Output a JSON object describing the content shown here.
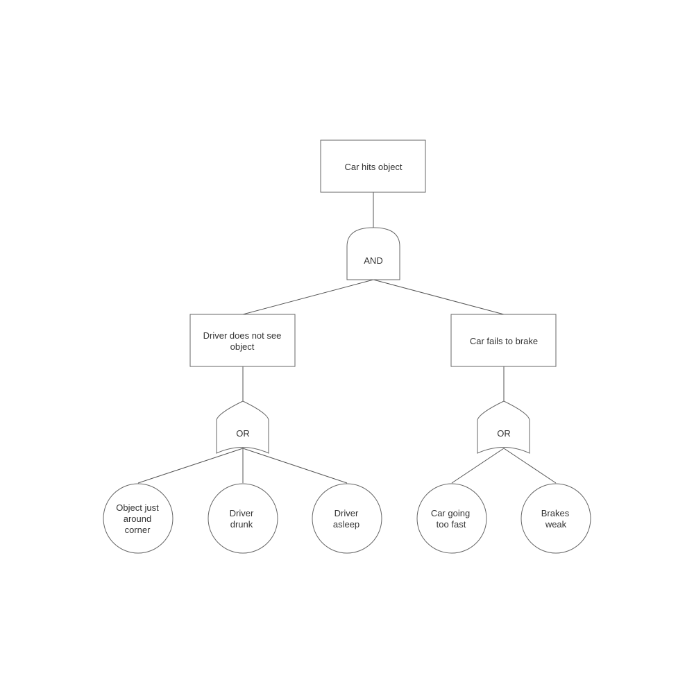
{
  "diagram": {
    "type": "fault-tree",
    "top_event": {
      "lines": [
        "Car hits object"
      ]
    },
    "and_gate": {
      "label": "AND"
    },
    "intermediate_events": [
      {
        "lines": [
          "Driver does not see",
          "object"
        ]
      },
      {
        "lines": [
          "Car fails to brake"
        ]
      }
    ],
    "or_gates": [
      {
        "label": "OR"
      },
      {
        "label": "OR"
      }
    ],
    "basic_events": [
      {
        "lines": [
          "Object just",
          "around",
          "corner"
        ]
      },
      {
        "lines": [
          "Driver",
          "drunk"
        ]
      },
      {
        "lines": [
          "Driver",
          "asleep"
        ]
      },
      {
        "lines": [
          "Car going",
          "too fast"
        ]
      },
      {
        "lines": [
          "Brakes",
          "weak"
        ]
      }
    ],
    "colors": {
      "stroke": "#666666",
      "text": "#333333",
      "background": "#ffffff"
    }
  }
}
